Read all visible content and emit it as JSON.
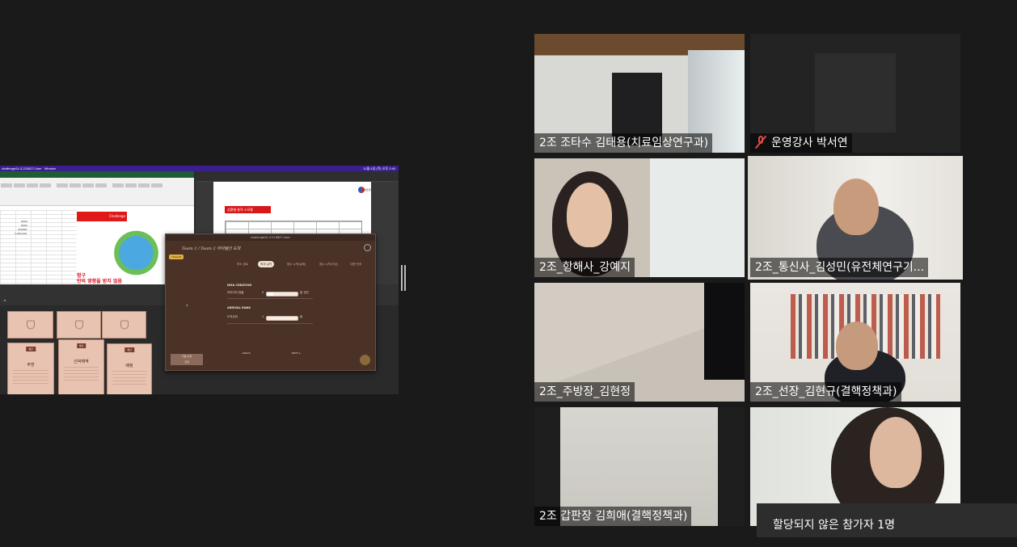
{
  "shared_screen": {
    "menubar": {
      "app": "challenge24-3-210827-User",
      "menu": "Window",
      "clock": "11월 4일 (목) 오후 2:40"
    },
    "excel": {
      "cells": [
        "9000",
        "8000",
        "200000",
        "1,000,000"
      ],
      "poster_brand": "Challenge",
      "poster_text_line1": "항구",
      "poster_text_line2": "만의 영향을 받지 않음"
    },
    "document": {
      "logo_text": "행정안전부",
      "red_heading": "상황별 물적 소모율",
      "table_head": [
        "구분",
        "장소",
        "점수",
        "점",
        "비용"
      ]
    },
    "cards": {
      "card1": {
        "tag": "생산",
        "title": "주방"
      },
      "card2": {
        "tag": "생산",
        "title": "선박해역"
      },
      "card3": {
        "tag": "생산",
        "title": "배정"
      }
    },
    "modal": {
      "window_title": "challenge24-3-210827-User",
      "header": "Team 1 / Team 2  아이템선 도착",
      "badge": "TOGGLE",
      "tabs": [
        "최소 경로",
        "최대 실적",
        "점수 누적(실제)",
        "점수 누적(가상)",
        "다음 단계"
      ],
      "active_tab": 1,
      "section1": "IDEA CREATION",
      "row1_label": "아이디어 창출",
      "row1_min": "0",
      "row1_value": "일 것인",
      "row1_level": 0.2,
      "section2": "ARRIVAL RANK",
      "row2_label": "도착순위",
      "row2_min": "1",
      "row2_value": "등",
      "row2_level": 0.0,
      "back_label": "BACK",
      "next_label": "NEXT",
      "status_label": "다음 단계",
      "status_value": "진행"
    }
  },
  "participants": [
    {
      "name": "2조 조타수 김태용(치료임상연구과)",
      "muted": false,
      "speaking": false
    },
    {
      "name": "운영강사 박서연",
      "muted": true,
      "speaking": false
    },
    {
      "name": "2조_항해사_강예지",
      "muted": false,
      "speaking": false
    },
    {
      "name": "2조_통신사_김성민(유전체연구기...",
      "muted": false,
      "speaking": true
    },
    {
      "name": "2조_주방장_김현정",
      "muted": false,
      "speaking": false
    },
    {
      "name": "2조_선장_김현규(결핵정책과)",
      "muted": false,
      "speaking": false
    },
    {
      "name": "2조 갑판장 김희애(결핵정책과)",
      "muted": false,
      "speaking": false
    },
    {
      "name": "",
      "muted": false,
      "speaking": false
    }
  ],
  "unassigned_label": "할당되지 않은 참가자 1명",
  "colors": {
    "speaker_highlight": "#c5e85c",
    "mute_red": "#e34848",
    "background": "#1a1a1a"
  }
}
